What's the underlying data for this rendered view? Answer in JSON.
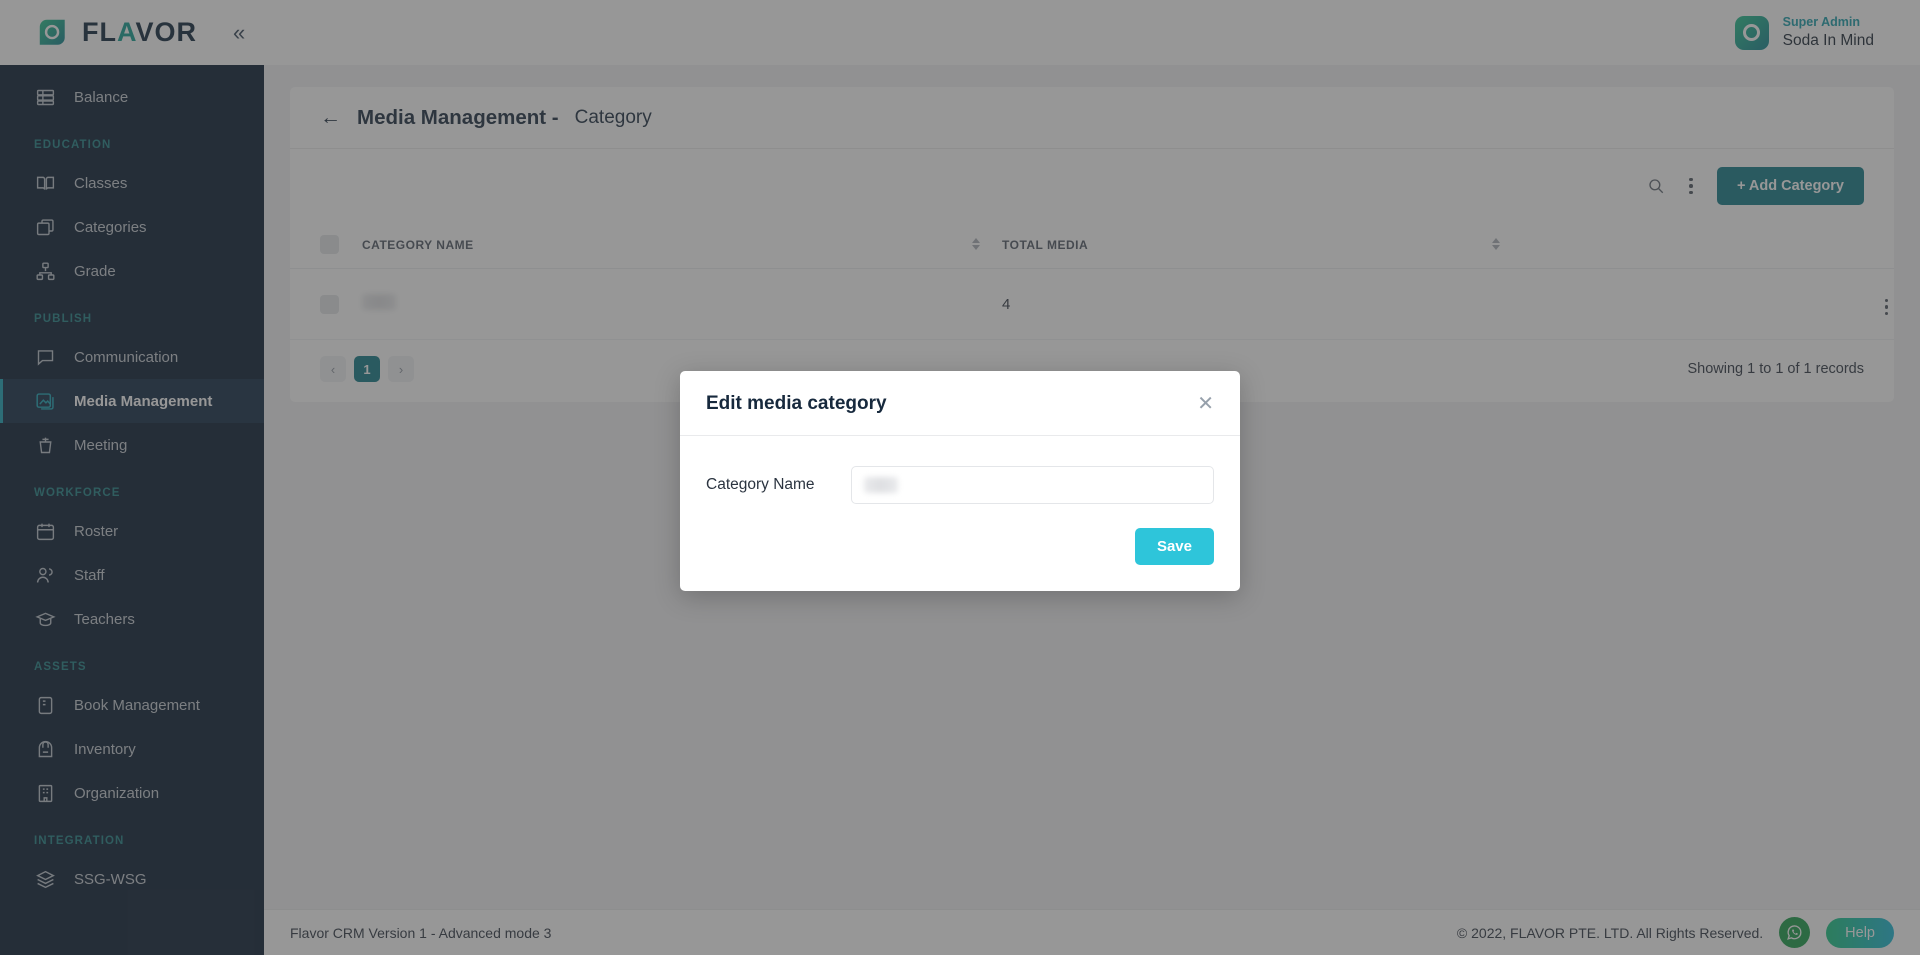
{
  "brand": {
    "name": "FLAVOR",
    "logo_icon": "flavor-logo-icon",
    "collapse_icon": "chevron-double-left-icon",
    "accent_teal": "#0f9b8e",
    "accent_dark": "#04182e",
    "primary_button": "#0f7886",
    "save_button": "#2ec5da"
  },
  "user": {
    "role": "Super Admin",
    "name": "Soda In Mind",
    "avatar_icon": "flavor-avatar-icon"
  },
  "sidebar": {
    "items": [
      {
        "label": "Balance",
        "icon": "balance-icon",
        "active": false,
        "section": null
      },
      {
        "label": "EDUCATION",
        "type": "section"
      },
      {
        "label": "Classes",
        "icon": "book-open-icon",
        "active": false
      },
      {
        "label": "Categories",
        "icon": "box-icon",
        "active": false
      },
      {
        "label": "Grade",
        "icon": "hierarchy-icon",
        "active": false
      },
      {
        "label": "PUBLISH",
        "type": "section"
      },
      {
        "label": "Communication",
        "icon": "chat-icon",
        "active": false
      },
      {
        "label": "Media Management",
        "icon": "image-icon",
        "active": true
      },
      {
        "label": "Meeting",
        "icon": "podium-icon",
        "active": false
      },
      {
        "label": "WORKFORCE",
        "type": "section"
      },
      {
        "label": "Roster",
        "icon": "calendar-icon",
        "active": false
      },
      {
        "label": "Staff",
        "icon": "users-icon",
        "active": false
      },
      {
        "label": "Teachers",
        "icon": "graduation-cap-icon",
        "active": false
      },
      {
        "label": "ASSETS",
        "type": "section"
      },
      {
        "label": "Book Management",
        "icon": "book-icon",
        "active": false
      },
      {
        "label": "Inventory",
        "icon": "backpack-icon",
        "active": false
      },
      {
        "label": "Organization",
        "icon": "building-icon",
        "active": false
      },
      {
        "label": "INTEGRATION",
        "type": "section"
      },
      {
        "label": "SSG-WSG",
        "icon": "layers-icon",
        "active": false
      }
    ]
  },
  "page": {
    "back_icon": "arrow-left-icon",
    "title": "Media Management -",
    "subtitle": "Category"
  },
  "toolbar": {
    "search_icon": "search-icon",
    "more_icon": "kebab-menu-icon",
    "add_label": "+ Add Category"
  },
  "table": {
    "columns": [
      "CATEGORY NAME",
      "TOTAL MEDIA"
    ],
    "rows": [
      {
        "category_name": "",
        "total_media": "4"
      }
    ],
    "row_action_icon": "kebab-menu-icon"
  },
  "pagination": {
    "prev": "‹",
    "next": "›",
    "current_page": "1",
    "records_text": "Showing 1 to 1 of 1 records"
  },
  "modal": {
    "title": "Edit media category",
    "close_icon": "close-icon",
    "field_label": "Category Name",
    "field_value": "",
    "field_placeholder": "",
    "save_label": "Save"
  },
  "footer": {
    "version": "Flavor CRM Version 1 - Advanced mode 3",
    "copyright": "© 2022, FLAVOR PTE. LTD. All Rights Reserved.",
    "whatsapp_icon": "whatsapp-icon",
    "help_label": "Help"
  }
}
